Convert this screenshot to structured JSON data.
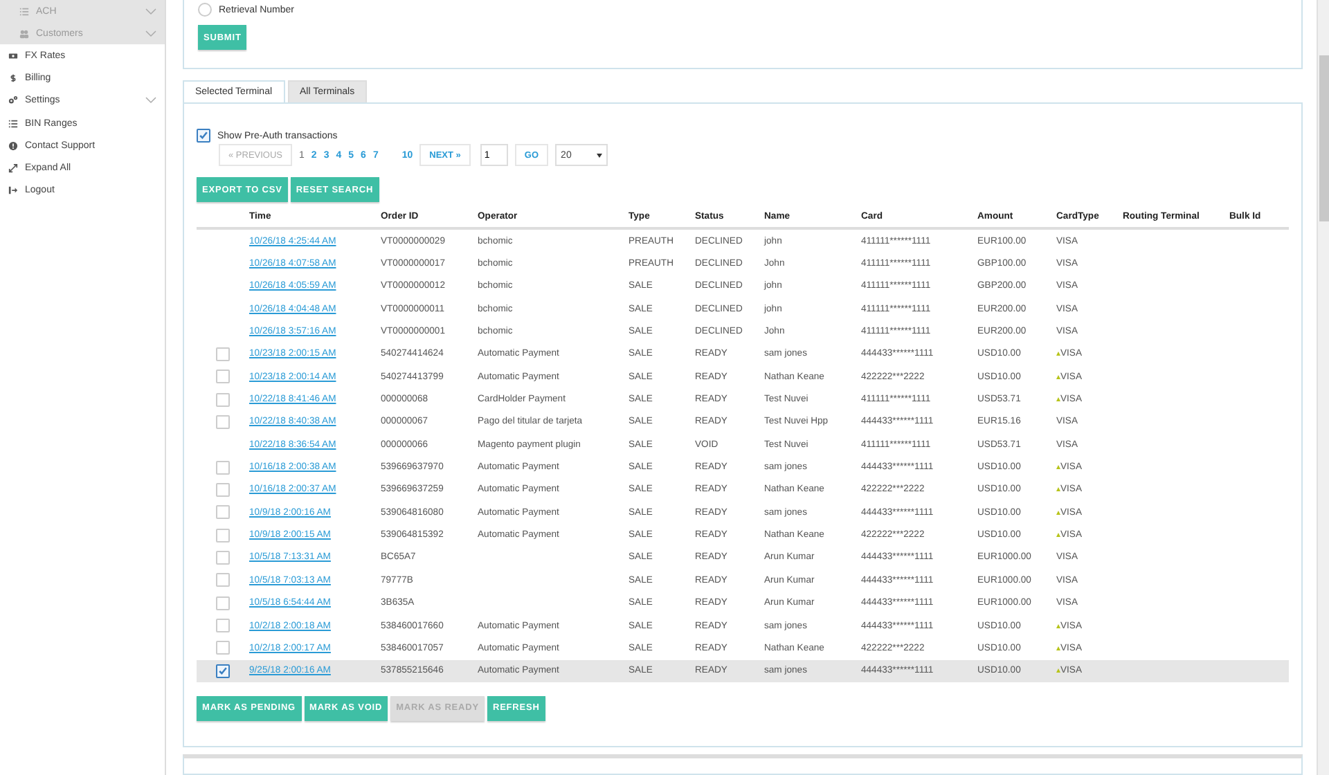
{
  "sidebar": {
    "items": [
      {
        "label": "ACH",
        "group": true,
        "expandable": true
      },
      {
        "label": "Customers",
        "group": true,
        "expandable": true
      },
      {
        "label": "FX Rates",
        "group": false,
        "expandable": false
      },
      {
        "label": "Billing",
        "group": false,
        "expandable": false
      },
      {
        "label": "Settings",
        "group": false,
        "expandable": true
      },
      {
        "label": "BIN Ranges",
        "group": false,
        "expandable": false
      },
      {
        "label": "Contact Support",
        "group": false,
        "expandable": false
      },
      {
        "label": "Expand All",
        "group": false,
        "expandable": false
      },
      {
        "label": "Logout",
        "group": false,
        "expandable": false
      }
    ]
  },
  "search_form": {
    "radio": {
      "label": "Retrieval Number",
      "selected": false
    },
    "submit": "SUBMIT"
  },
  "tabs": [
    {
      "label": "Selected Terminal",
      "selected": true
    },
    {
      "label": "All Terminals",
      "selected": false
    }
  ],
  "preauth": {
    "label": "Show Pre-Auth transactions",
    "checked": true
  },
  "pagination": {
    "previous": {
      "label": "« PREVIOUS",
      "disabled": true
    },
    "pages": [
      {
        "label": "1",
        "selected": true
      },
      {
        "label": "2",
        "selected": false
      },
      {
        "label": "3",
        "selected": false
      },
      {
        "label": "4",
        "selected": false
      },
      {
        "label": "5",
        "selected": false
      },
      {
        "label": "6",
        "selected": false
      },
      {
        "label": "7",
        "selected": false
      },
      {
        "label": "10",
        "selected": false
      }
    ],
    "next": {
      "label": "NEXT »",
      "disabled": false
    },
    "page_input": "1",
    "go": "GO",
    "page_size": "20"
  },
  "actions": [
    "EXPORT TO CSV",
    "RESET SEARCH"
  ],
  "table": {
    "columns": [
      "Time",
      "Order ID",
      "Operator",
      "Type",
      "Status",
      "Name",
      "Card",
      "Amount",
      "CardType",
      "Routing Terminal",
      "Bulk Id"
    ],
    "rows": [
      {
        "time": "10/26/18 4:25:44 AM",
        "order_id": "VT0000000029",
        "operator": "bchomic",
        "type": "PREAUTH",
        "status": "DECLINED",
        "name": "john",
        "card": "411111******1111",
        "amount": "EUR100.00",
        "card_type": "VISA",
        "marker": false,
        "selectable": false,
        "selected": false
      },
      {
        "time": "10/26/18 4:07:58 AM",
        "order_id": "VT0000000017",
        "operator": "bchomic",
        "type": "PREAUTH",
        "status": "DECLINED",
        "name": "John",
        "card": "411111******1111",
        "amount": "GBP100.00",
        "card_type": "VISA",
        "marker": false,
        "selectable": false,
        "selected": false
      },
      {
        "time": "10/26/18 4:05:59 AM",
        "order_id": "VT0000000012",
        "operator": "bchomic",
        "type": "SALE",
        "status": "DECLINED",
        "name": "john",
        "card": "411111******1111",
        "amount": "GBP200.00",
        "card_type": "VISA",
        "marker": false,
        "selectable": false,
        "selected": false
      },
      {
        "time": "10/26/18 4:04:48 AM",
        "order_id": "VT0000000011",
        "operator": "bchomic",
        "type": "SALE",
        "status": "DECLINED",
        "name": "john",
        "card": "411111******1111",
        "amount": "EUR200.00",
        "card_type": "VISA",
        "marker": false,
        "selectable": false,
        "selected": false
      },
      {
        "time": "10/26/18 3:57:16 AM",
        "order_id": "VT0000000001",
        "operator": "bchomic",
        "type": "SALE",
        "status": "DECLINED",
        "name": "John",
        "card": "411111******1111",
        "amount": "EUR200.00",
        "card_type": "VISA",
        "marker": false,
        "selectable": false,
        "selected": false
      },
      {
        "time": "10/23/18 2:00:15 AM",
        "order_id": "540274414624",
        "operator": "Automatic Payment",
        "type": "SALE",
        "status": "READY",
        "name": "sam jones",
        "card": "444433******1111",
        "amount": "USD10.00",
        "card_type": "VISA",
        "marker": true,
        "selectable": true,
        "checked": false,
        "selected": false
      },
      {
        "time": "10/23/18 2:00:14 AM",
        "order_id": "540274413799",
        "operator": "Automatic Payment",
        "type": "SALE",
        "status": "READY",
        "name": "Nathan Keane",
        "card": "422222***2222",
        "amount": "USD10.00",
        "card_type": "VISA",
        "marker": true,
        "selectable": true,
        "checked": false,
        "selected": false
      },
      {
        "time": "10/22/18 8:41:46 AM",
        "order_id": "000000068",
        "operator": "CardHolder Payment",
        "type": "SALE",
        "status": "READY",
        "name": "Test Nuvei",
        "card": "411111******1111",
        "amount": "USD53.71",
        "card_type": "VISA",
        "marker": true,
        "selectable": true,
        "checked": false,
        "selected": false
      },
      {
        "time": "10/22/18 8:40:38 AM",
        "order_id": "000000067",
        "operator": "Pago del titular de tarjeta",
        "type": "SALE",
        "status": "READY",
        "name": "Test Nuvei Hpp",
        "card": "444433******1111",
        "amount": "EUR15.16",
        "card_type": "VISA",
        "marker": false,
        "selectable": true,
        "checked": false,
        "selected": false
      },
      {
        "time": "10/22/18 8:36:54 AM",
        "order_id": "000000066",
        "operator": "Magento payment plugin",
        "type": "SALE",
        "status": "VOID",
        "name": "Test Nuvei",
        "card": "411111******1111",
        "amount": "USD53.71",
        "card_type": "VISA",
        "marker": false,
        "selectable": false,
        "selected": false
      },
      {
        "time": "10/16/18 2:00:38 AM",
        "order_id": "539669637970",
        "operator": "Automatic Payment",
        "type": "SALE",
        "status": "READY",
        "name": "sam jones",
        "card": "444433******1111",
        "amount": "USD10.00",
        "card_type": "VISA",
        "marker": true,
        "selectable": true,
        "checked": false,
        "selected": false
      },
      {
        "time": "10/16/18 2:00:37 AM",
        "order_id": "539669637259",
        "operator": "Automatic Payment",
        "type": "SALE",
        "status": "READY",
        "name": "Nathan Keane",
        "card": "422222***2222",
        "amount": "USD10.00",
        "card_type": "VISA",
        "marker": true,
        "selectable": true,
        "checked": false,
        "selected": false
      },
      {
        "time": "10/9/18 2:00:16 AM",
        "order_id": "539064816080",
        "operator": "Automatic Payment",
        "type": "SALE",
        "status": "READY",
        "name": "sam jones",
        "card": "444433******1111",
        "amount": "USD10.00",
        "card_type": "VISA",
        "marker": true,
        "selectable": true,
        "checked": false,
        "selected": false
      },
      {
        "time": "10/9/18 2:00:15 AM",
        "order_id": "539064815392",
        "operator": "Automatic Payment",
        "type": "SALE",
        "status": "READY",
        "name": "Nathan Keane",
        "card": "422222***2222",
        "amount": "USD10.00",
        "card_type": "VISA",
        "marker": true,
        "selectable": true,
        "checked": false,
        "selected": false
      },
      {
        "time": "10/5/18 7:13:31 AM",
        "order_id": "BC65A7",
        "type": "SALE",
        "status": "READY",
        "name": "Arun Kumar",
        "card": "444433******1111",
        "amount": "EUR1000.00",
        "card_type": "VISA",
        "marker": false,
        "selectable": true,
        "checked": false,
        "selected": false
      },
      {
        "time": "10/5/18 7:03:13 AM",
        "order_id": "79777B",
        "type": "SALE",
        "status": "READY",
        "name": "Arun Kumar",
        "card": "444433******1111",
        "amount": "EUR1000.00",
        "card_type": "VISA",
        "marker": false,
        "selectable": true,
        "checked": false,
        "selected": false
      },
      {
        "time": "10/5/18 6:54:44 AM",
        "order_id": "3B635A",
        "type": "SALE",
        "status": "READY",
        "name": "Arun Kumar",
        "card": "444433******1111",
        "amount": "EUR1000.00",
        "card_type": "VISA",
        "marker": false,
        "selectable": true,
        "checked": false,
        "selected": false
      },
      {
        "time": "10/2/18 2:00:18 AM",
        "order_id": "538460017660",
        "operator": "Automatic Payment",
        "type": "SALE",
        "status": "READY",
        "name": "sam jones",
        "card": "444433******1111",
        "amount": "USD10.00",
        "card_type": "VISA",
        "marker": true,
        "selectable": true,
        "checked": false,
        "selected": false
      },
      {
        "time": "10/2/18 2:00:17 AM",
        "order_id": "538460017057",
        "operator": "Automatic Payment",
        "type": "SALE",
        "status": "READY",
        "name": "Nathan Keane",
        "card": "422222***2222",
        "amount": "USD10.00",
        "card_type": "VISA",
        "marker": true,
        "selectable": true,
        "checked": false,
        "selected": false
      },
      {
        "time": "9/25/18 2:00:16 AM",
        "order_id": "537855215646",
        "operator": "Automatic Payment",
        "type": "SALE",
        "status": "READY",
        "name": "sam jones",
        "card": "444433******1111",
        "amount": "USD10.00",
        "card_type": "VISA",
        "marker": true,
        "selectable": true,
        "checked": true,
        "selected": true
      }
    ]
  },
  "bulk_actions": [
    {
      "label": "MARK AS PENDING",
      "disabled": false
    },
    {
      "label": "MARK AS VOID",
      "disabled": false
    },
    {
      "label": "MARK AS READY",
      "disabled": true
    },
    {
      "label": "REFRESH",
      "disabled": false
    }
  ]
}
